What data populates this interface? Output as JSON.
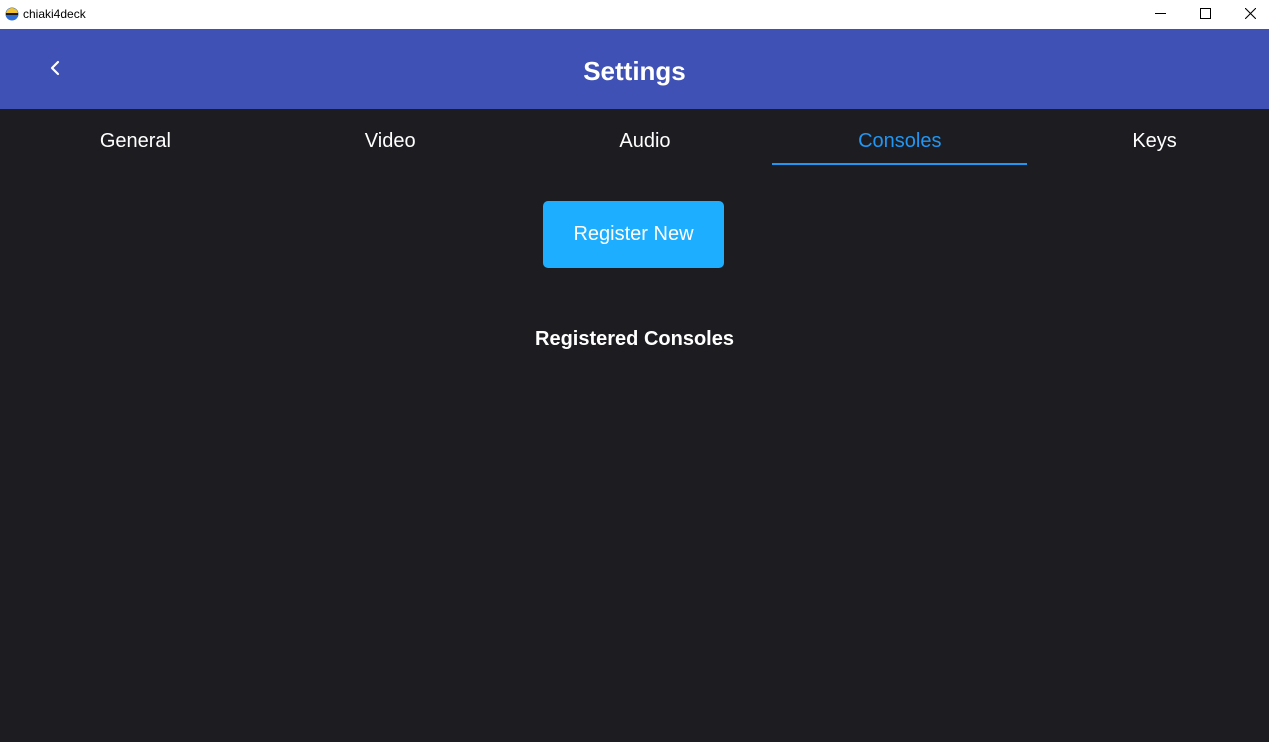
{
  "window": {
    "title": "chiaki4deck",
    "minimize_icon": "minimize-icon",
    "maximize_icon": "maximize-icon",
    "close_icon": "close-icon"
  },
  "header": {
    "title": "Settings",
    "back_icon": "chevron-left-icon"
  },
  "tabs": [
    {
      "label": "General",
      "active": false
    },
    {
      "label": "Video",
      "active": false
    },
    {
      "label": "Audio",
      "active": false
    },
    {
      "label": "Consoles",
      "active": true
    },
    {
      "label": "Keys",
      "active": false
    }
  ],
  "consoles": {
    "register_button_label": "Register New",
    "section_title": "Registered Consoles",
    "registered": []
  },
  "colors": {
    "header_bg": "#3f51b5",
    "body_bg": "#1d1c21",
    "accent": "#2196f3",
    "button_bg": "#1eaeff"
  }
}
